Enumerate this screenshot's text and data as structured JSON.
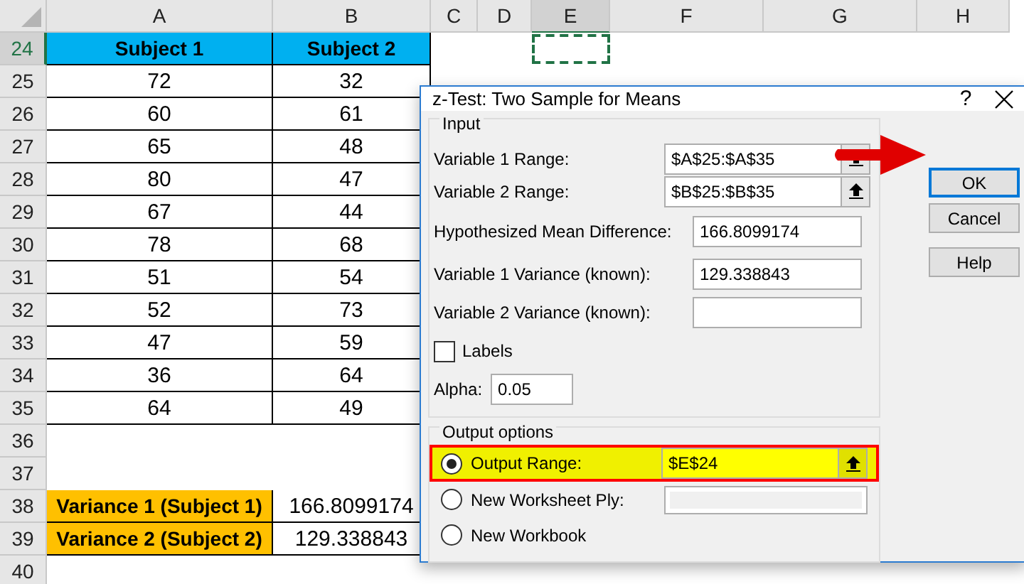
{
  "sheet": {
    "columns": [
      {
        "label": "A",
        "selected": false
      },
      {
        "label": "B",
        "selected": false
      },
      {
        "label": "C",
        "selected": false
      },
      {
        "label": "D",
        "selected": false
      },
      {
        "label": "E",
        "selected": true
      },
      {
        "label": "F",
        "selected": false
      },
      {
        "label": "G",
        "selected": false
      },
      {
        "label": "H",
        "selected": false
      }
    ],
    "rows": [
      {
        "number": "24",
        "selected": true,
        "cells": [
          {
            "text": "Subject 1",
            "kind": "header"
          },
          {
            "text": "Subject 2",
            "kind": "header"
          }
        ]
      },
      {
        "number": "25",
        "selected": false,
        "cells": [
          {
            "text": "72",
            "kind": "data"
          },
          {
            "text": "32",
            "kind": "data"
          }
        ]
      },
      {
        "number": "26",
        "selected": false,
        "cells": [
          {
            "text": "60",
            "kind": "data"
          },
          {
            "text": "61",
            "kind": "data"
          }
        ]
      },
      {
        "number": "27",
        "selected": false,
        "cells": [
          {
            "text": "65",
            "kind": "data"
          },
          {
            "text": "48",
            "kind": "data"
          }
        ]
      },
      {
        "number": "28",
        "selected": false,
        "cells": [
          {
            "text": "80",
            "kind": "data"
          },
          {
            "text": "47",
            "kind": "data"
          }
        ]
      },
      {
        "number": "29",
        "selected": false,
        "cells": [
          {
            "text": "67",
            "kind": "data"
          },
          {
            "text": "44",
            "kind": "data"
          }
        ]
      },
      {
        "number": "30",
        "selected": false,
        "cells": [
          {
            "text": "78",
            "kind": "data"
          },
          {
            "text": "68",
            "kind": "data"
          }
        ]
      },
      {
        "number": "31",
        "selected": false,
        "cells": [
          {
            "text": "51",
            "kind": "data"
          },
          {
            "text": "54",
            "kind": "data"
          }
        ]
      },
      {
        "number": "32",
        "selected": false,
        "cells": [
          {
            "text": "52",
            "kind": "data"
          },
          {
            "text": "73",
            "kind": "data"
          }
        ]
      },
      {
        "number": "33",
        "selected": false,
        "cells": [
          {
            "text": "47",
            "kind": "data"
          },
          {
            "text": "59",
            "kind": "data"
          }
        ]
      },
      {
        "number": "34",
        "selected": false,
        "cells": [
          {
            "text": "36",
            "kind": "data"
          },
          {
            "text": "64",
            "kind": "data"
          }
        ]
      },
      {
        "number": "35",
        "selected": false,
        "cells": [
          {
            "text": "64",
            "kind": "data"
          },
          {
            "text": "49",
            "kind": "data"
          }
        ]
      },
      {
        "number": "36",
        "selected": false,
        "cells": []
      },
      {
        "number": "37",
        "selected": false,
        "cells": []
      },
      {
        "number": "38",
        "selected": false,
        "cells": [
          {
            "text": "Variance 1 (Subject 1)",
            "kind": "label"
          },
          {
            "text": "166.8099174",
            "kind": "value"
          }
        ]
      },
      {
        "number": "39",
        "selected": false,
        "cells": [
          {
            "text": "Variance 2 (Subject 2)",
            "kind": "label"
          },
          {
            "text": "129.338843",
            "kind": "value"
          }
        ]
      },
      {
        "number": "40",
        "selected": false,
        "cells": []
      }
    ]
  },
  "dialog": {
    "title": "z-Test: Two Sample for Means",
    "help_glyph": "?",
    "input": {
      "title": "Input",
      "fields": [
        {
          "label": "Variable 1 Range:",
          "value": "$A$25:$A$35",
          "kind": "range"
        },
        {
          "label": "Variable 2 Range:",
          "value": "$B$25:$B$35",
          "kind": "range"
        },
        {
          "label": "Hypothesized Mean Difference:",
          "value": "166.8099174",
          "kind": "text"
        },
        {
          "label": "Variable 1 Variance (known):",
          "value": "129.338843",
          "kind": "text"
        },
        {
          "label": "Variable 2 Variance (known):",
          "kind": "text"
        }
      ],
      "labels_checkbox": {
        "label": "Labels",
        "checked": false
      },
      "alpha": {
        "label": "Alpha:",
        "value": "0.05"
      }
    },
    "output": {
      "title": "Output options",
      "options": [
        {
          "label": "Output Range:",
          "selected": true,
          "highlighted": true,
          "value": "$E$24",
          "kind": "range"
        },
        {
          "label": "New Worksheet Ply:",
          "selected": false,
          "highlighted": false,
          "kind": "text"
        },
        {
          "label": "New Workbook",
          "selected": false,
          "highlighted": false,
          "kind": "none"
        }
      ]
    },
    "buttons": [
      {
        "label": "OK",
        "default": true
      },
      {
        "label": "Cancel",
        "default": false
      },
      {
        "label": "Help",
        "default": false
      }
    ]
  }
}
